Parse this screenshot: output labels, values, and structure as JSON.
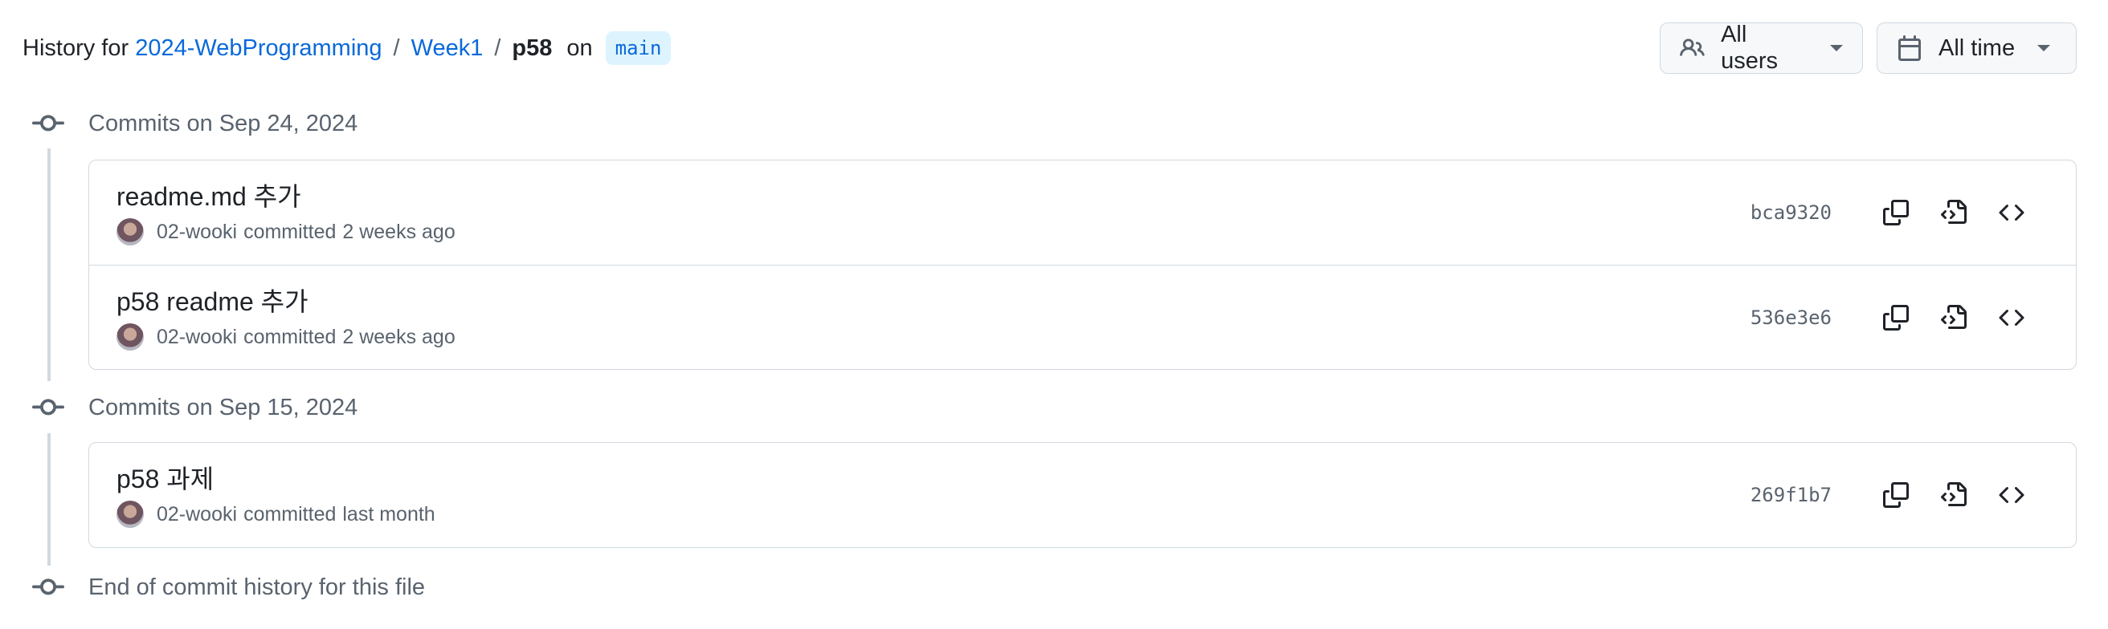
{
  "header": {
    "prefix": "History for",
    "repo": "2024-WebProgramming",
    "sep1": "/",
    "folder": "Week1",
    "sep2": "/",
    "file": "p58",
    "on": "on",
    "branch": "main"
  },
  "filters": {
    "users_label": "All users",
    "time_label": "All time"
  },
  "groups": [
    {
      "heading": "Commits on Sep 24, 2024",
      "commits": [
        {
          "message": "readme.md 추가",
          "author": "02-wooki",
          "action": "committed",
          "time": "2 weeks ago",
          "sha": "bca9320"
        },
        {
          "message": "p58 readme 추가",
          "author": "02-wooki",
          "action": "committed",
          "time": "2 weeks ago",
          "sha": "536e3e6"
        }
      ]
    },
    {
      "heading": "Commits on Sep 15, 2024",
      "commits": [
        {
          "message": "p58 과제",
          "author": "02-wooki",
          "action": "committed",
          "time": "last month",
          "sha": "269f1b7"
        }
      ]
    }
  ],
  "footer": {
    "end_text": "End of commit history for this file"
  },
  "icons": {
    "users": "people-icon",
    "time": "calendar-icon",
    "commit": "git-commit-icon",
    "copy": "copy-icon",
    "browse_file": "file-code-icon",
    "browse_repo": "code-icon"
  },
  "colors": {
    "link": "#0969da",
    "branch_bg": "#ddf4ff",
    "muted": "#59636e",
    "border": "#d1d9e0"
  }
}
